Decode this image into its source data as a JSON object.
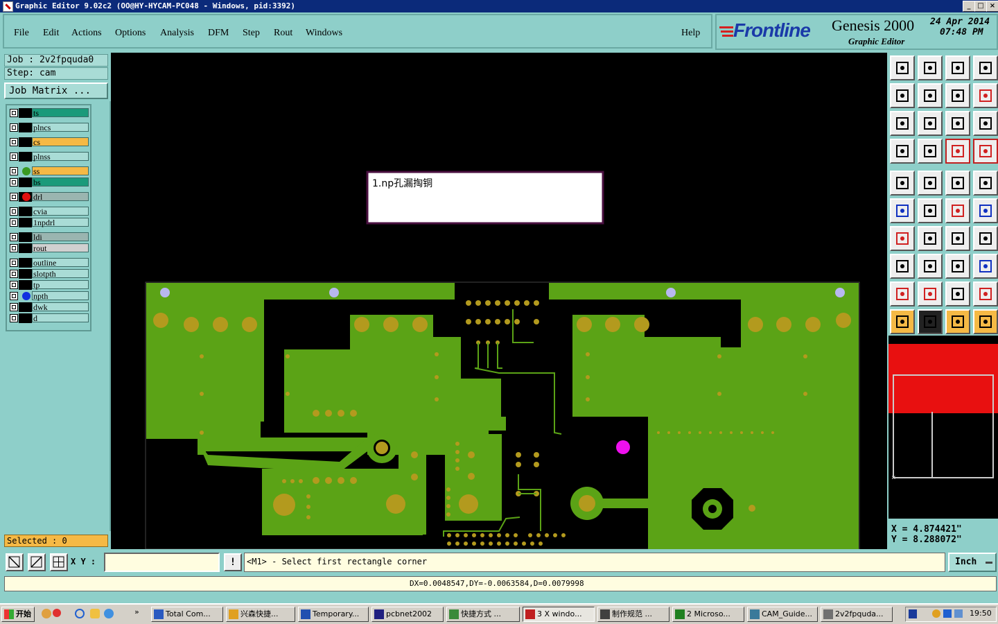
{
  "window": {
    "title": "Graphic Editor 9.02c2  (OO@HY-HYCAM-PC048 - Windows, pid:3392)"
  },
  "menu": {
    "items": [
      "File",
      "Edit",
      "Actions",
      "Options",
      "Analysis",
      "DFM",
      "Step",
      "Rout",
      "Windows"
    ],
    "help": "Help"
  },
  "brand": {
    "logo": "Frontline",
    "product": "Genesis 2000",
    "subtitle": "Graphic Editor",
    "date": "24 Apr 2014",
    "time": "07:48 PM"
  },
  "job": {
    "job_label": "Job : 2v2fpquda0",
    "step_label": "Step: cam",
    "matrix_button": "Job Matrix ..."
  },
  "layers": [
    {
      "name": "ts",
      "color": "#1a9a7a"
    },
    {
      "name": "plncs",
      "color": "#a9dcd6"
    },
    {
      "name": "cs",
      "color": "#f5b945"
    },
    {
      "name": "plnss",
      "color": "#a9dcd6"
    },
    {
      "name": "ss",
      "color": "#f5b945",
      "dot": "#3a9a22"
    },
    {
      "name": "bs",
      "color": "#1a9a7a"
    },
    {
      "name": "drl",
      "color": "#9ab5b0",
      "dot": "#e01010",
      "active": true
    },
    {
      "name": "cvia",
      "color": "#a9dcd6"
    },
    {
      "name": "1npdrl",
      "color": "#a9dcd6"
    },
    {
      "name": "ldi",
      "color": "#9ab5b0"
    },
    {
      "name": "rout",
      "color": "#d0d0d0"
    },
    {
      "name": "outline",
      "color": "#a9dcd6"
    },
    {
      "name": "slotpth",
      "color": "#a9dcd6"
    },
    {
      "name": "tp",
      "color": "#a9dcd6"
    },
    {
      "name": "npth",
      "color": "#a9dcd6",
      "dot": "#1030e0"
    },
    {
      "name": "dwk",
      "color": "#a9dcd6"
    },
    {
      "name": "d",
      "color": "#a9dcd6"
    }
  ],
  "selected": "Selected : 0",
  "note": "1.np孔漏掏铜",
  "coords": {
    "x": "X  =  4.874421\"",
    "y": "Y  =  8.288072\""
  },
  "input": {
    "xy_label": "X Y :",
    "prompt": "<M1> - Select first rectangle corner",
    "unit": "Inch"
  },
  "measure": "DX=0.0048547,DY=-0.0063584,D=0.0079998",
  "taskbar": {
    "start": "开始",
    "tasks": [
      "Total Com...",
      "兴森快捷...",
      "Temporary...",
      "pcbnet2002",
      "快捷方式 ...",
      "3 X windo...",
      "制作规范 ...",
      "2 Microso...",
      "CAM_Guide...",
      "2v2fpquda..."
    ],
    "clock": "19:50"
  },
  "colors": {
    "board": "#5ba316",
    "pad": "#b39a1e",
    "panel": "#8ecfc9",
    "via": "#b0b0e8",
    "marker": "#ee10ee"
  }
}
